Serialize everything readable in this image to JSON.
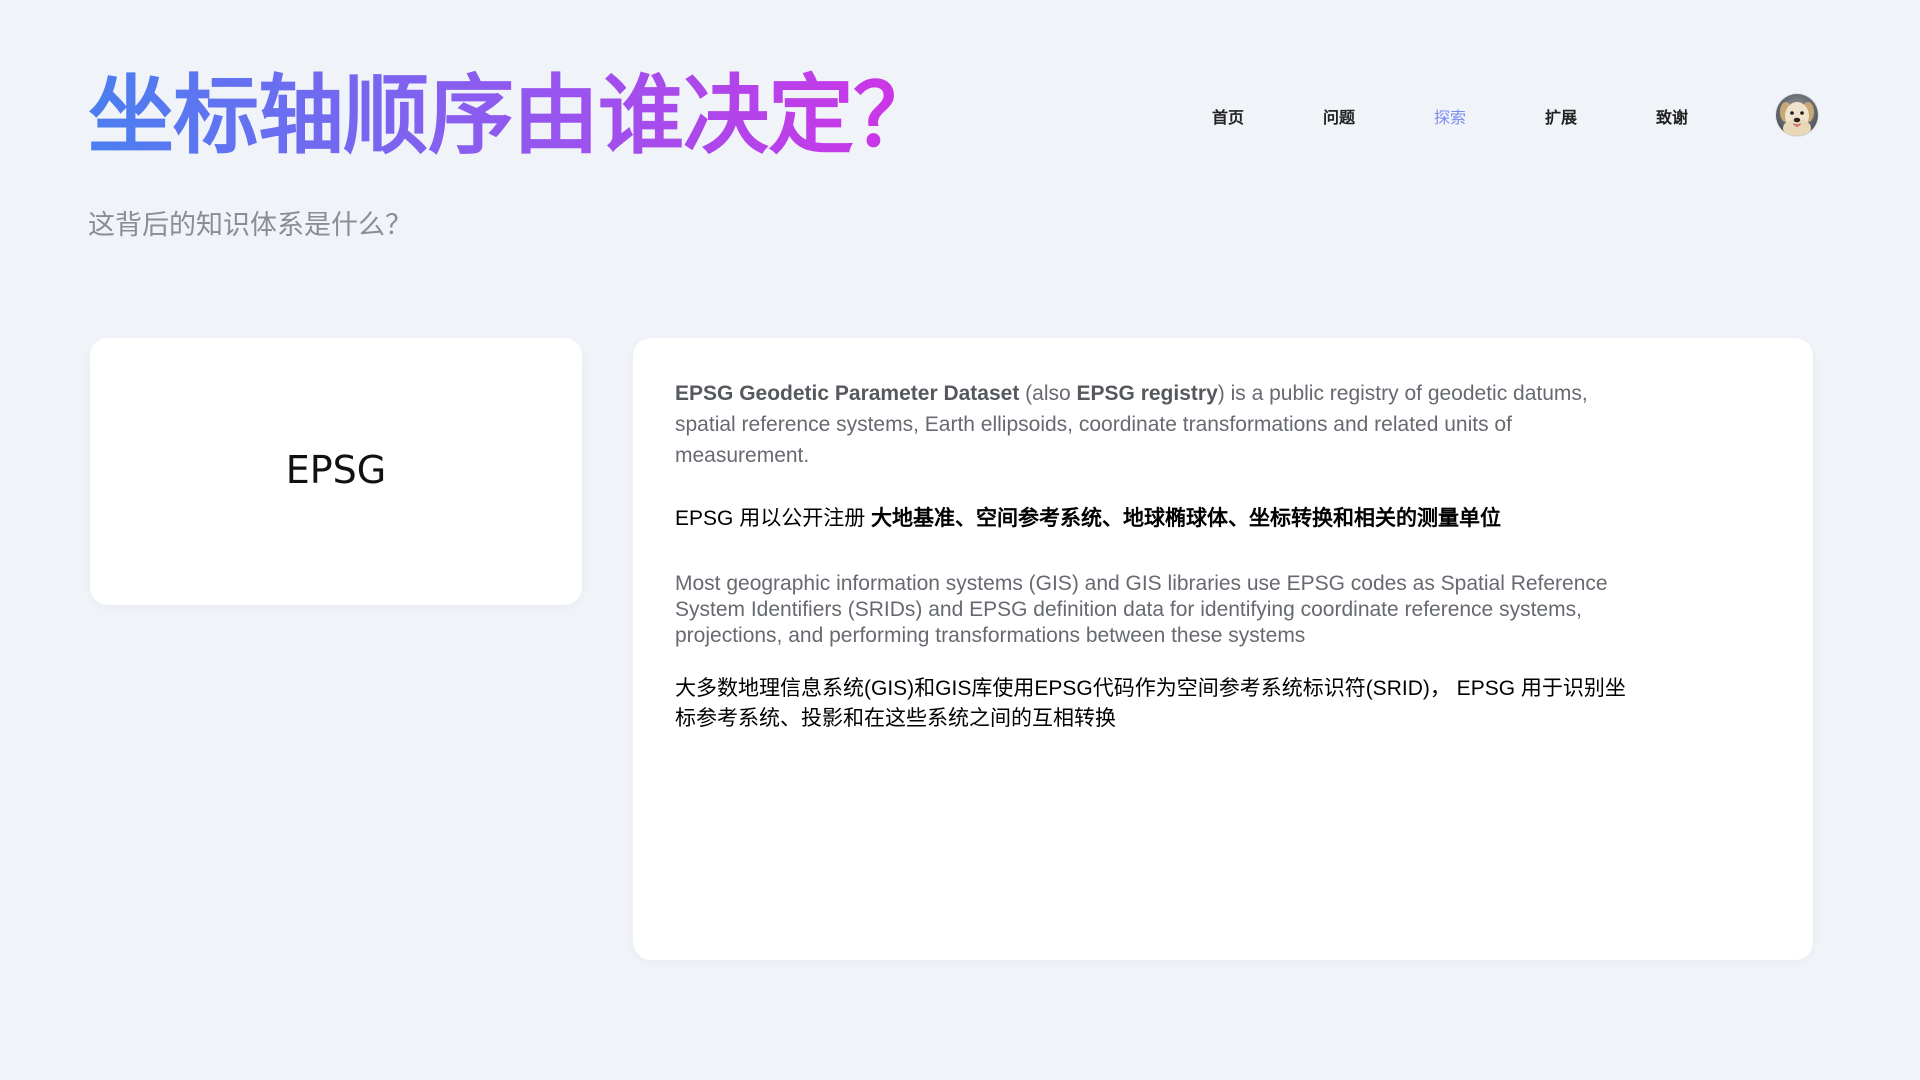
{
  "header": {
    "title": "坐标轴顺序由谁决定？",
    "subtitle": "这背后的知识体系是什么？"
  },
  "nav": {
    "items": [
      {
        "label": "首页",
        "active": false
      },
      {
        "label": "问题",
        "active": false
      },
      {
        "label": "探索",
        "active": true
      },
      {
        "label": "扩展",
        "active": false
      },
      {
        "label": "致谢",
        "active": false
      }
    ],
    "avatar_icon": "dog-avatar-icon"
  },
  "left_card": {
    "label": "EPSG"
  },
  "right_card": {
    "p1": {
      "bold1": "EPSG Geodetic Parameter Dataset",
      "text1": " (also ",
      "bold2": "EPSG registry",
      "text2": ") is a public registry of geodetic datums, spatial reference systems, Earth ellipsoids, coordinate transformations and related units of measurement."
    },
    "p2": {
      "text": "EPSG 用以公开注册 ",
      "bold": "大地基准、空间参考系统、地球椭球体、坐标转换和相关的测量单位"
    },
    "p3": "Most geographic information systems (GIS) and GIS libraries use EPSG codes as Spatial Reference System Identifiers (SRIDs) and EPSG definition data for identifying coordinate reference systems, projections, and performing transformations between these systems",
    "p4": "大多数地理信息系统(GIS)和GIS库使用EPSG代码作为空间参考系统标识符(SRID)， EPSG 用于识别坐标参考系统、投影和在这些系统之间的互相转换"
  },
  "colors": {
    "background": "#f0f3f8",
    "title_gradient_start": "#4a7ff0",
    "title_gradient_end": "#d232e6",
    "nav_active": "#7c8cf2"
  }
}
